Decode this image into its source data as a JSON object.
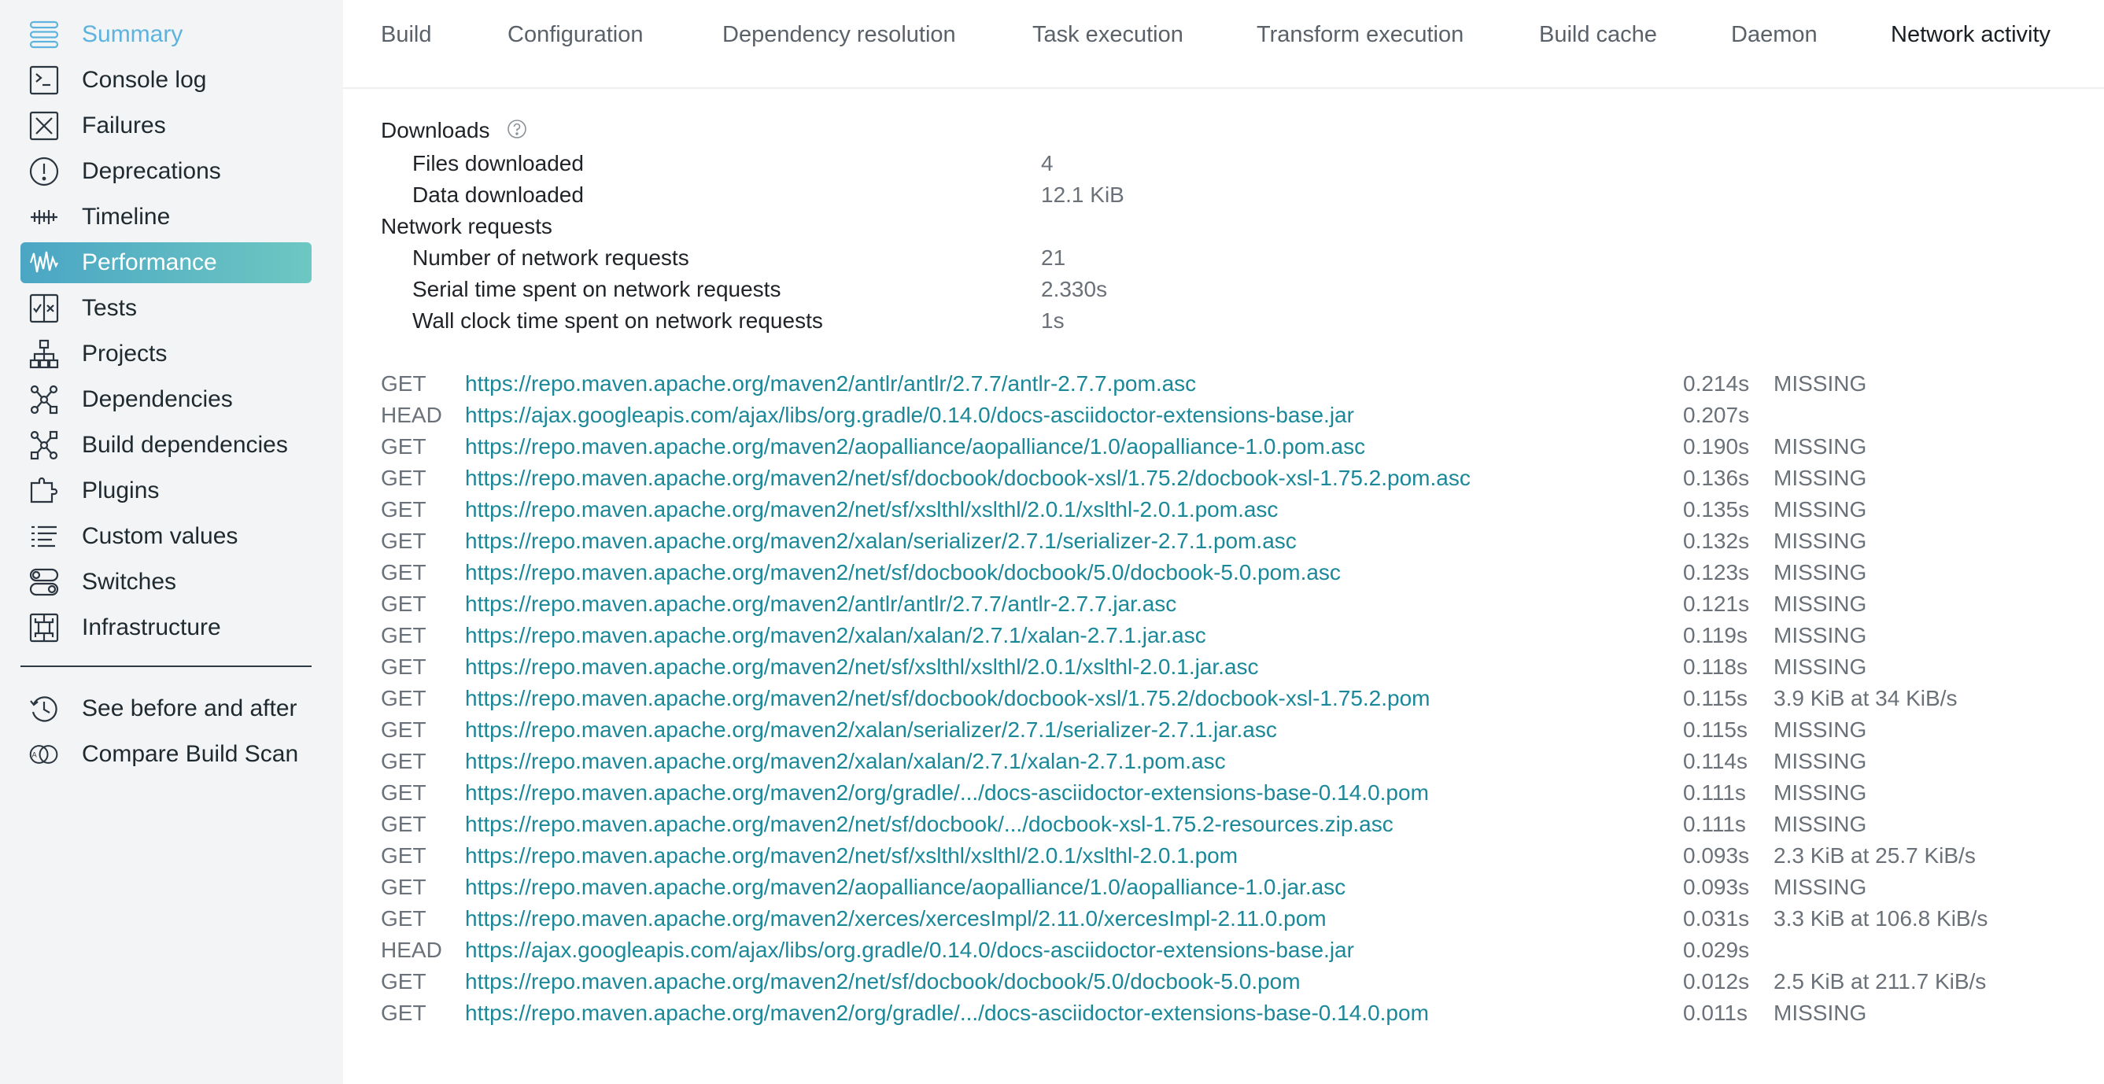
{
  "sidebar": {
    "items": [
      {
        "label": "Summary",
        "icon": "summary-list-icon"
      },
      {
        "label": "Console log",
        "icon": "console-icon"
      },
      {
        "label": "Failures",
        "icon": "x-box-icon"
      },
      {
        "label": "Deprecations",
        "icon": "exclamation-circle-icon"
      },
      {
        "label": "Timeline",
        "icon": "timeline-icon"
      },
      {
        "label": "Performance",
        "icon": "waveform-icon"
      },
      {
        "label": "Tests",
        "icon": "tests-icon"
      },
      {
        "label": "Projects",
        "icon": "hierarchy-icon"
      },
      {
        "label": "Dependencies",
        "icon": "dependencies-icon"
      },
      {
        "label": "Build dependencies",
        "icon": "build-dependencies-icon"
      },
      {
        "label": "Plugins",
        "icon": "puzzle-icon"
      },
      {
        "label": "Custom values",
        "icon": "list-icon"
      },
      {
        "label": "Switches",
        "icon": "toggle-icon"
      },
      {
        "label": "Infrastructure",
        "icon": "circuit-icon"
      }
    ],
    "extra": [
      {
        "label": "See before and after",
        "icon": "history-icon"
      },
      {
        "label": "Compare Build Scan",
        "icon": "compare-icon"
      }
    ],
    "active_color": "#4aa6c4"
  },
  "tabs": [
    "Build",
    "Configuration",
    "Dependency resolution",
    "Task execution",
    "Transform execution",
    "Build cache",
    "Daemon",
    "Network activity"
  ],
  "summary": {
    "downloads_title": "Downloads",
    "files_downloaded_label": "Files downloaded",
    "files_downloaded_value": "4",
    "data_downloaded_label": "Data downloaded",
    "data_downloaded_value": "12.1 KiB",
    "network_requests_title": "Network requests",
    "num_requests_label": "Number of network requests",
    "num_requests_value": "21",
    "serial_time_label": "Serial time spent on network requests",
    "serial_time_value": "2.330s",
    "wall_time_label": "Wall clock time spent on network requests",
    "wall_time_value": "1s"
  },
  "requests": [
    {
      "method": "GET",
      "url": "https://repo.maven.apache.org/maven2/antlr/antlr/2.7.7/antlr-2.7.7.pom.asc",
      "time": "0.214s",
      "result": "MISSING"
    },
    {
      "method": "HEAD",
      "url": "https://ajax.googleapis.com/ajax/libs/org.gradle/0.14.0/docs-asciidoctor-extensions-base.jar",
      "time": "0.207s",
      "result": ""
    },
    {
      "method": "GET",
      "url": "https://repo.maven.apache.org/maven2/aopalliance/aopalliance/1.0/aopalliance-1.0.pom.asc",
      "time": "0.190s",
      "result": "MISSING"
    },
    {
      "method": "GET",
      "url": "https://repo.maven.apache.org/maven2/net/sf/docbook/docbook-xsl/1.75.2/docbook-xsl-1.75.2.pom.asc",
      "time": "0.136s",
      "result": "MISSING"
    },
    {
      "method": "GET",
      "url": "https://repo.maven.apache.org/maven2/net/sf/xslthl/xslthl/2.0.1/xslthl-2.0.1.pom.asc",
      "time": "0.135s",
      "result": "MISSING"
    },
    {
      "method": "GET",
      "url": "https://repo.maven.apache.org/maven2/xalan/serializer/2.7.1/serializer-2.7.1.pom.asc",
      "time": "0.132s",
      "result": "MISSING"
    },
    {
      "method": "GET",
      "url": "https://repo.maven.apache.org/maven2/net/sf/docbook/docbook/5.0/docbook-5.0.pom.asc",
      "time": "0.123s",
      "result": "MISSING"
    },
    {
      "method": "GET",
      "url": "https://repo.maven.apache.org/maven2/antlr/antlr/2.7.7/antlr-2.7.7.jar.asc",
      "time": "0.121s",
      "result": "MISSING"
    },
    {
      "method": "GET",
      "url": "https://repo.maven.apache.org/maven2/xalan/xalan/2.7.1/xalan-2.7.1.jar.asc",
      "time": "0.119s",
      "result": "MISSING"
    },
    {
      "method": "GET",
      "url": "https://repo.maven.apache.org/maven2/net/sf/xslthl/xslthl/2.0.1/xslthl-2.0.1.jar.asc",
      "time": "0.118s",
      "result": "MISSING"
    },
    {
      "method": "GET",
      "url": "https://repo.maven.apache.org/maven2/net/sf/docbook/docbook-xsl/1.75.2/docbook-xsl-1.75.2.pom",
      "time": "0.115s",
      "result": "3.9 KiB at 34 KiB/s"
    },
    {
      "method": "GET",
      "url": "https://repo.maven.apache.org/maven2/xalan/serializer/2.7.1/serializer-2.7.1.jar.asc",
      "time": "0.115s",
      "result": "MISSING"
    },
    {
      "method": "GET",
      "url": "https://repo.maven.apache.org/maven2/xalan/xalan/2.7.1/xalan-2.7.1.pom.asc",
      "time": "0.114s",
      "result": "MISSING"
    },
    {
      "method": "GET",
      "url": "https://repo.maven.apache.org/maven2/org/gradle/.../docs-asciidoctor-extensions-base-0.14.0.pom",
      "time": "0.111s",
      "result": "MISSING"
    },
    {
      "method": "GET",
      "url": "https://repo.maven.apache.org/maven2/net/sf/docbook/.../docbook-xsl-1.75.2-resources.zip.asc",
      "time": "0.111s",
      "result": "MISSING"
    },
    {
      "method": "GET",
      "url": "https://repo.maven.apache.org/maven2/net/sf/xslthl/xslthl/2.0.1/xslthl-2.0.1.pom",
      "time": "0.093s",
      "result": "2.3 KiB at 25.7 KiB/s"
    },
    {
      "method": "GET",
      "url": "https://repo.maven.apache.org/maven2/aopalliance/aopalliance/1.0/aopalliance-1.0.jar.asc",
      "time": "0.093s",
      "result": "MISSING"
    },
    {
      "method": "GET",
      "url": "https://repo.maven.apache.org/maven2/xerces/xercesImpl/2.11.0/xercesImpl-2.11.0.pom",
      "time": "0.031s",
      "result": "3.3 KiB at 106.8 KiB/s"
    },
    {
      "method": "HEAD",
      "url": "https://ajax.googleapis.com/ajax/libs/org.gradle/0.14.0/docs-asciidoctor-extensions-base.jar",
      "time": "0.029s",
      "result": ""
    },
    {
      "method": "GET",
      "url": "https://repo.maven.apache.org/maven2/net/sf/docbook/docbook/5.0/docbook-5.0.pom",
      "time": "0.012s",
      "result": "2.5 KiB at 211.7 KiB/s"
    },
    {
      "method": "GET",
      "url": "https://repo.maven.apache.org/maven2/org/gradle/.../docs-asciidoctor-extensions-base-0.14.0.pom",
      "time": "0.011s",
      "result": "MISSING"
    }
  ],
  "colors": {
    "link": "#1a8899",
    "muted": "#6b7178",
    "sidebar_bg": "#f3f4f5",
    "summary_blue": "#5db3dd"
  }
}
